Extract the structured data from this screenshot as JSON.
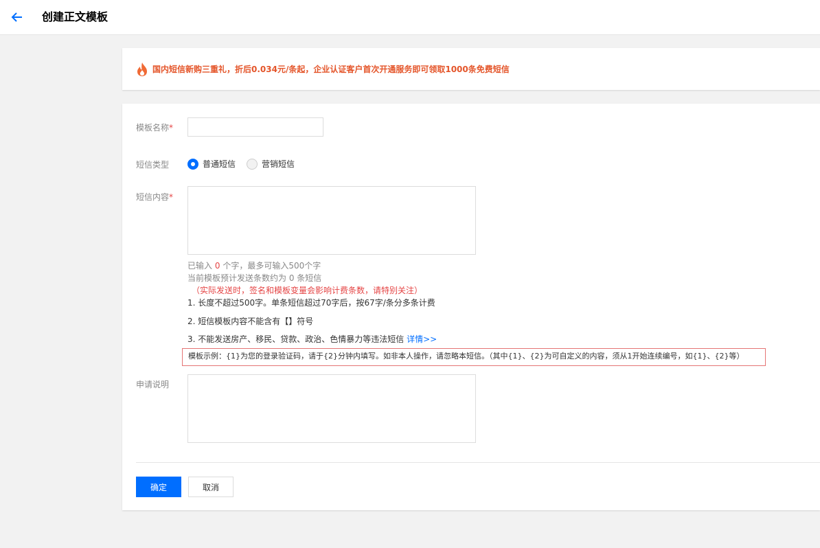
{
  "header": {
    "title": "创建正文模板",
    "back_icon": "arrow-left-icon"
  },
  "promo": {
    "icon": "fire-icon",
    "text": "国内短信新购三重礼，折后0.034元/条起，企业认证客户首次开通服务即可领取1000条免费短信"
  },
  "form": {
    "name_label": "模板名称",
    "name_value": "",
    "type_label": "短信类型",
    "type_options": [
      {
        "label": "普通短信",
        "selected": true
      },
      {
        "label": "营销短信",
        "selected": false
      }
    ],
    "content_label": "短信内容",
    "content_value": "",
    "count_prefix": "已输入",
    "count_value": "0",
    "count_suffix": "个字，最多可输入500个字",
    "estimate_text": "当前模板预计发送条数约为 0 条短信",
    "warning_text": "（实际发送时，签名和模板变量会影响计费条数，请特别关注）",
    "rules": [
      "1. 长度不超过500字。单条短信超过70字后，按67字/条分多条计费",
      "2. 短信模板内容不能含有【】符号",
      "3. 不能发送房产、移民、贷款、政治、色情暴力等违法短信"
    ],
    "details_link": "详情>>",
    "example_text": "模板示例：{1}为您的登录验证码，请于{2}分钟内填写。如非本人操作，请忽略本短信。（其中{1}、{2}为可自定义的内容，须从1开始连续编号，如{1}、{2}等）",
    "remark_label": "申请说明",
    "remark_value": "",
    "required_mark": "*"
  },
  "actions": {
    "confirm_label": "确定",
    "cancel_label": "取消"
  },
  "colors": {
    "accent": "#006eff",
    "promo": "#e4552a",
    "required": "#e54545"
  }
}
